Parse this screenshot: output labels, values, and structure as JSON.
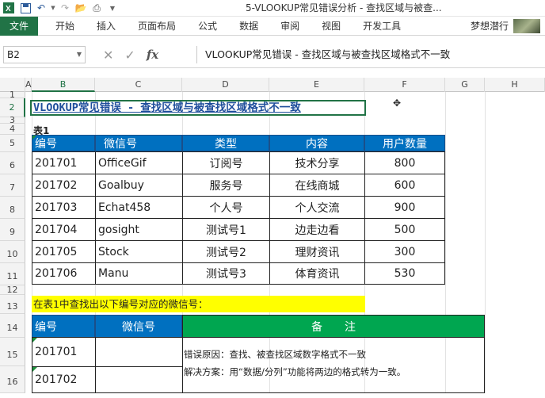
{
  "window": {
    "title": "5-VLOOKUP常见错误分析 - 查找区域与被查...",
    "quick_access": [
      "save-icon",
      "undo-icon",
      "redo-icon",
      "open-icon",
      "print-icon"
    ]
  },
  "ribbon": {
    "file_tab": "文件",
    "tabs": [
      "开始",
      "插入",
      "页面布局",
      "公式",
      "数据",
      "审阅",
      "视图",
      "开发工具"
    ],
    "user": "梦想潜行"
  },
  "formula_bar": {
    "name_box": "B2",
    "formula": "VLOOKUP常见错误 - 查找区域与被查找区域格式不一致"
  },
  "columns": [
    "A",
    "B",
    "C",
    "D",
    "E",
    "F",
    "G",
    "H"
  ],
  "rows": [
    "1",
    "2",
    "3",
    "4",
    "5",
    "6",
    "7",
    "8",
    "9",
    "10",
    "11",
    "12",
    "13",
    "14",
    "15",
    "16"
  ],
  "sheet": {
    "title": "VLOOKUP常见错误 - 查找区域与被查找区域格式不一致",
    "table1_label": "表1",
    "table1": {
      "headers": [
        "编号",
        "微信号",
        "类型",
        "内容",
        "用户数量"
      ],
      "rows": [
        [
          "201701",
          "OfficeGif",
          "订阅号",
          "技术分享",
          "800"
        ],
        [
          "201702",
          "Goalbuy",
          "服务号",
          "在线商城",
          "600"
        ],
        [
          "201703",
          "Echat458",
          "个人号",
          "个人交流",
          "900"
        ],
        [
          "201704",
          "gosight",
          "测试号1",
          "边走边看",
          "500"
        ],
        [
          "201705",
          "Stock",
          "测试号2",
          "理财资讯",
          "300"
        ],
        [
          "201706",
          "Manu",
          "测试号3",
          "体育资讯",
          "530"
        ]
      ]
    },
    "lookup_prompt": "在表1中查找出以下编号对应的微信号：",
    "table2": {
      "headers": [
        "编号",
        "微信号",
        "备　　注"
      ],
      "rows": [
        [
          "201701",
          ""
        ],
        [
          "201702",
          ""
        ]
      ],
      "note_line1": "错误原因：查找、被查找区域数字格式不一致",
      "note_line2": "解决方案：用“数据/分列”功能将两边的格式转为一致。"
    }
  },
  "colors": {
    "excel_green": "#217346",
    "header_blue": "#0070c0",
    "header_green": "#00a650",
    "highlight_yellow": "#ffff00"
  }
}
